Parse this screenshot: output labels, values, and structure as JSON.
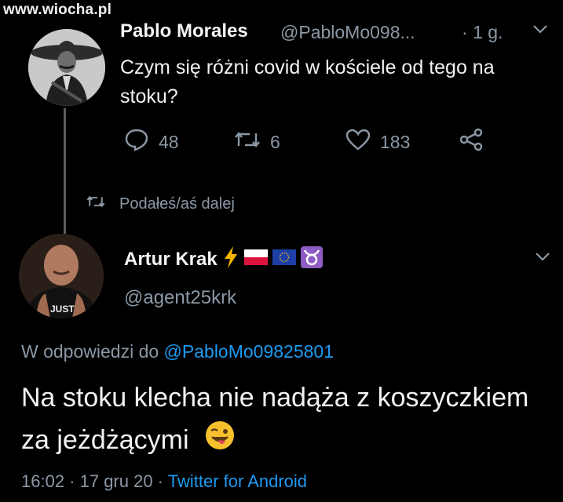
{
  "watermark": "www.wiocha.pl",
  "original_tweet": {
    "author_name": "Pablo Morales",
    "author_handle": "@PabloMo098...",
    "time_sep": "·",
    "time": "1 g.",
    "text": "Czym się różni covid w kościele od tego na stoku?",
    "actions": {
      "reply_count": "48",
      "retweet_count": "6",
      "like_count": "183"
    }
  },
  "retweet_notice": "Podałeś/aś dalej",
  "reply_tweet": {
    "author_name": "Artur Krak",
    "author_handle": "@agent25krk",
    "name_emojis": [
      "lightning-emoji",
      "poland-flag-emoji",
      "eu-flag-emoji",
      "taurus-emoji"
    ],
    "replying_label": "W odpowiedzi do",
    "replying_to": "@PabloMo09825801",
    "text": "Na stoku klecha nie nadąża z koszyczkiem za jeżdżącymi",
    "avatar_shirt_text": "JUST",
    "timestamp": "16:02 · 17 gru 20 ·",
    "client": "Twitter for Android"
  },
  "colors": {
    "background": "#000000",
    "secondary_text": "#8b98a5",
    "link": "#1d9bf0"
  }
}
